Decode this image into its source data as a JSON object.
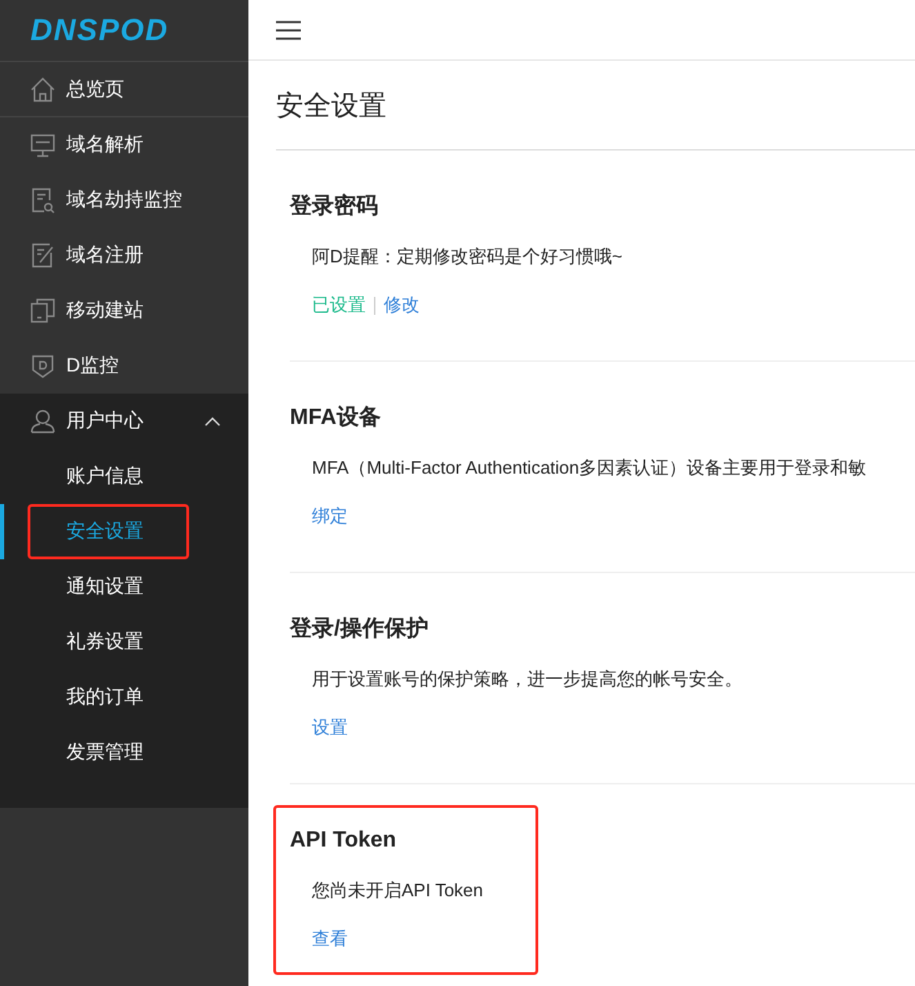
{
  "sidebar": {
    "logo": "DNSPOD",
    "items": [
      {
        "label": "总览页",
        "selected": false
      },
      {
        "label": "域名解析",
        "selected": false
      },
      {
        "label": "域名劫持监控",
        "selected": false
      },
      {
        "label": "域名注册",
        "selected": false
      },
      {
        "label": "移动建站",
        "selected": false
      },
      {
        "label": "D监控",
        "selected": false
      },
      {
        "label": "用户中心",
        "selected": false,
        "expanded": true,
        "children": [
          {
            "label": "账户信息",
            "selected": false,
            "highlighted": false
          },
          {
            "label": "安全设置",
            "selected": true,
            "highlighted": true
          },
          {
            "label": "通知设置",
            "selected": false,
            "highlighted": false
          },
          {
            "label": "礼券设置",
            "selected": false,
            "highlighted": false
          },
          {
            "label": "我的订单",
            "selected": false,
            "highlighted": false
          },
          {
            "label": "发票管理",
            "selected": false,
            "highlighted": false
          }
        ]
      }
    ]
  },
  "page": {
    "title": "安全设置"
  },
  "sections": [
    {
      "title": "登录密码",
      "description": "阿D提醒：定期修改密码是个好习惯哦~",
      "highlighted": false,
      "links": [
        {
          "text": "已设置",
          "kind": "status"
        },
        {
          "text": "修改",
          "kind": "link"
        }
      ]
    },
    {
      "title": "MFA设备",
      "description": "MFA（Multi-Factor Authentication多因素认证）设备主要用于登录和敏",
      "highlighted": false,
      "links": [
        {
          "text": "绑定",
          "kind": "link"
        }
      ]
    },
    {
      "title": "登录/操作保护",
      "description": "用于设置账号的保护策略，进一步提高您的帐号安全。",
      "highlighted": false,
      "links": [
        {
          "text": "设置",
          "kind": "link"
        }
      ]
    },
    {
      "title": "API Token",
      "description": "您尚未开启API Token",
      "highlighted": true,
      "links": [
        {
          "text": "查看",
          "kind": "link"
        }
      ]
    }
  ]
}
